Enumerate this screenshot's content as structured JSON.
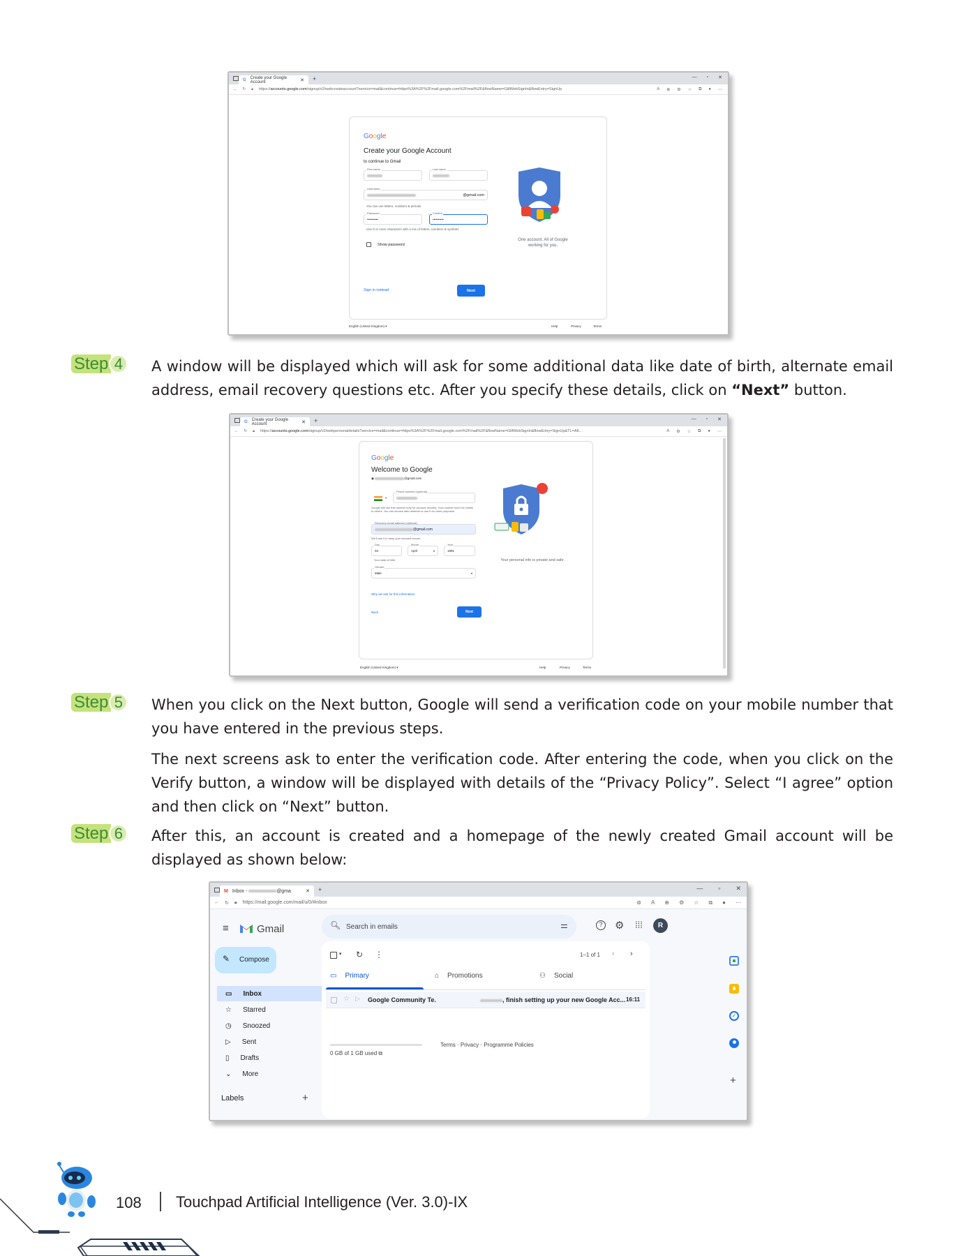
{
  "screens": {
    "signup": {
      "tab_title": "Create your Google Account",
      "url_prefix": "https://",
      "url_domain": "accounts.google.com",
      "url_rest": "/signup/v2/webcreateaccount?service=mail&continue=https%3A%2F%2Fmail.google.com%2Fmail%2F&flowName=GlifWebSignIn&flowEntry=SignUp",
      "logo": [
        "G",
        "o",
        "o",
        "g",
        "l",
        "e"
      ],
      "heading": "Create your Google Account",
      "subheading": "to continue to Gmail",
      "first_name_label": "First name",
      "last_name_label": "Last name",
      "username_label": "Username",
      "username_suffix": "@gmail.com",
      "username_hint": "You can use letters, numbers & periods",
      "password_label": "Password",
      "password_value": "••••••••••",
      "confirm_label": "Confirm",
      "confirm_value": "••••••••••",
      "password_hint": "Use 8 or more characters with a mix of letters, numbers & symbols",
      "show_password": "Show password",
      "sign_in_instead": "Sign in instead",
      "next": "Next",
      "caption": "One account. All of Google working for you.",
      "language": "English (United Kingdom)",
      "footer_links": [
        "Help",
        "Privacy",
        "Terms"
      ]
    },
    "welcome": {
      "tab_title": "Create your Google Account",
      "url_prefix": "https://",
      "url_domain": "accounts.google.com",
      "url_rest": "/signup/v2/webpersonaldetails?service=mail&continue=https%3A%2F%2Fmail.google.com%2Fmail%2F&flowName=GlifWebSignIn&flowEntry=SignUp&TL=AK...",
      "logo": [
        "G",
        "o",
        "o",
        "g",
        "l",
        "e"
      ],
      "heading": "Welcome to Google",
      "email_suffix": "@gmail.com",
      "phone_label": "Phone number (optional)",
      "phone_note": "Google will use this number only for account security. Your number won't be visible to others. You can choose later whether to use it for other purposes.",
      "recovery_label": "Recovery email address (optional)",
      "recovery_suffix": "@gmail.com",
      "recovery_note": "We'll use it to keep your account secure",
      "day_label": "Day",
      "day_value": "03",
      "month_label": "Month",
      "month_value": "April",
      "year_label": "Year",
      "year_value": "1991",
      "dob_note": "Your date of birth",
      "gender_label": "Gender",
      "gender_value": "Male",
      "why_link": "Why we ask for this information",
      "back": "Back",
      "next": "Next",
      "caption": "Your personal info is private and safe",
      "language": "English (United Kingdom)",
      "footer_links": [
        "Help",
        "Privacy",
        "Terms"
      ]
    },
    "gmail": {
      "tab_title": "Inbox",
      "tab_suffix": "@gma",
      "url": "https://mail.google.com/mail/u/0/#inbox",
      "app_name": "Gmail",
      "search_placeholder": "Search in emails",
      "avatar_letter": "R",
      "compose": "Compose",
      "nav": [
        "Inbox",
        "Starred",
        "Snoozed",
        "Sent",
        "Drafts",
        "More"
      ],
      "labels": "Labels",
      "pagination": "1–1 of 1",
      "tabs": [
        "Primary",
        "Promotions",
        "Social"
      ],
      "email": {
        "sender": "Google Community Te.",
        "subject": ", finish setting up your new Google Acc...",
        "time": "16:11"
      },
      "storage": "0 GB of 1 GB used",
      "footer": "Terms · Privacy · Programme Policies",
      "colors": {
        "accent": "#0b57d0",
        "active_bg": "#d3e3fd",
        "compose_bg": "#c2e7ff",
        "avatar": "#3c4a5c"
      }
    }
  },
  "steps": [
    {
      "word": "Step",
      "number": "4"
    },
    {
      "word": "Step",
      "number": "5"
    },
    {
      "word": "Step",
      "number": "6"
    }
  ],
  "text": {
    "step4_a": "A window will be displayed which will ask for some additional data like date of birth, alternate email address, email recovery questions etc. After you specify these details, click on ",
    "step4_bold": "“Next”",
    "step4_b": " button.",
    "step5_p1": "When you click on the Next button, Google will send a verification code on your mobile number that you have entered in the previous steps.",
    "step5_p2": "The next screens ask to enter the verification code. After entering the code, when you click on the Verify button, a window will be displayed with details of the “Privacy Policy”. Select “I agree” option and then click on “Next” button.",
    "step6": "After this, an account is created and a homepage of the newly created Gmail account will be displayed as shown below:"
  },
  "footer": {
    "page_number": "108",
    "book_title": "Touchpad Artificial Intelligence (Ver. 3.0)-IX"
  },
  "colors": {
    "step_badge": "#c6e27a",
    "step_text": "#3b8c3a",
    "google_blue": "#1a73e8"
  }
}
